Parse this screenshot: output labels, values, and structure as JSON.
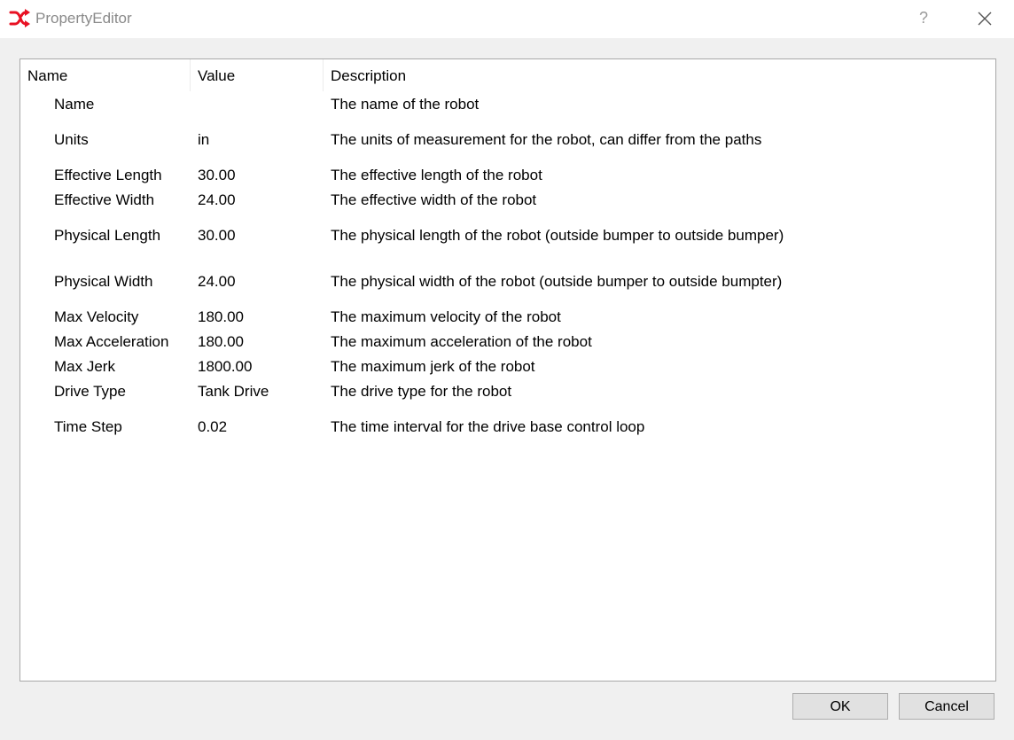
{
  "window": {
    "title": "PropertyEditor",
    "help_label": "?",
    "accent_color": "#e81123"
  },
  "table": {
    "columns": [
      "Name",
      "Value",
      "Description"
    ],
    "rows": [
      {
        "name": "Name",
        "value": "",
        "description": "The name of the robot"
      },
      {
        "name": "Units",
        "value": "in",
        "description": "The units of measurement for the robot, can differ from the paths"
      },
      {
        "name": "Effective Length",
        "value": "30.00",
        "description": "The effective length of the robot"
      },
      {
        "name": "Effective Width",
        "value": "24.00",
        "description": "The effective width of the robot"
      },
      {
        "name": "Physical Length",
        "value": "30.00",
        "description": "The physical length of the robot (outside bumper to outside bumper)"
      },
      {
        "name": "Physical Width",
        "value": "24.00",
        "description": "The physical width of the robot (outside bumper to outside bumpter)"
      },
      {
        "name": "Max Velocity",
        "value": "180.00",
        "description": "The maximum velocity of the robot"
      },
      {
        "name": "Max Acceleration",
        "value": "180.00",
        "description": "The maximum acceleration of the robot"
      },
      {
        "name": "Max Jerk",
        "value": "1800.00",
        "description": "The maximum jerk of the robot"
      },
      {
        "name": "Drive Type",
        "value": "Tank Drive",
        "description": "The drive type for the robot"
      },
      {
        "name": "Time Step",
        "value": "0.02",
        "description": "The time interval for the drive base control loop"
      }
    ]
  },
  "buttons": {
    "ok_label": "OK",
    "cancel_label": "Cancel"
  }
}
